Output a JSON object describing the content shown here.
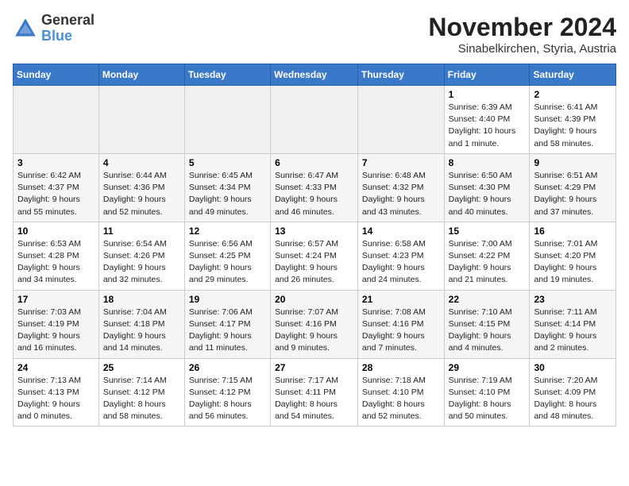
{
  "logo": {
    "line1": "General",
    "line2": "Blue"
  },
  "title": "November 2024",
  "location": "Sinabelkirchen, Styria, Austria",
  "weekdays": [
    "Sunday",
    "Monday",
    "Tuesday",
    "Wednesday",
    "Thursday",
    "Friday",
    "Saturday"
  ],
  "weeks": [
    [
      {
        "day": "",
        "info": ""
      },
      {
        "day": "",
        "info": ""
      },
      {
        "day": "",
        "info": ""
      },
      {
        "day": "",
        "info": ""
      },
      {
        "day": "",
        "info": ""
      },
      {
        "day": "1",
        "info": "Sunrise: 6:39 AM\nSunset: 4:40 PM\nDaylight: 10 hours and 1 minute."
      },
      {
        "day": "2",
        "info": "Sunrise: 6:41 AM\nSunset: 4:39 PM\nDaylight: 9 hours and 58 minutes."
      }
    ],
    [
      {
        "day": "3",
        "info": "Sunrise: 6:42 AM\nSunset: 4:37 PM\nDaylight: 9 hours and 55 minutes."
      },
      {
        "day": "4",
        "info": "Sunrise: 6:44 AM\nSunset: 4:36 PM\nDaylight: 9 hours and 52 minutes."
      },
      {
        "day": "5",
        "info": "Sunrise: 6:45 AM\nSunset: 4:34 PM\nDaylight: 9 hours and 49 minutes."
      },
      {
        "day": "6",
        "info": "Sunrise: 6:47 AM\nSunset: 4:33 PM\nDaylight: 9 hours and 46 minutes."
      },
      {
        "day": "7",
        "info": "Sunrise: 6:48 AM\nSunset: 4:32 PM\nDaylight: 9 hours and 43 minutes."
      },
      {
        "day": "8",
        "info": "Sunrise: 6:50 AM\nSunset: 4:30 PM\nDaylight: 9 hours and 40 minutes."
      },
      {
        "day": "9",
        "info": "Sunrise: 6:51 AM\nSunset: 4:29 PM\nDaylight: 9 hours and 37 minutes."
      }
    ],
    [
      {
        "day": "10",
        "info": "Sunrise: 6:53 AM\nSunset: 4:28 PM\nDaylight: 9 hours and 34 minutes."
      },
      {
        "day": "11",
        "info": "Sunrise: 6:54 AM\nSunset: 4:26 PM\nDaylight: 9 hours and 32 minutes."
      },
      {
        "day": "12",
        "info": "Sunrise: 6:56 AM\nSunset: 4:25 PM\nDaylight: 9 hours and 29 minutes."
      },
      {
        "day": "13",
        "info": "Sunrise: 6:57 AM\nSunset: 4:24 PM\nDaylight: 9 hours and 26 minutes."
      },
      {
        "day": "14",
        "info": "Sunrise: 6:58 AM\nSunset: 4:23 PM\nDaylight: 9 hours and 24 minutes."
      },
      {
        "day": "15",
        "info": "Sunrise: 7:00 AM\nSunset: 4:22 PM\nDaylight: 9 hours and 21 minutes."
      },
      {
        "day": "16",
        "info": "Sunrise: 7:01 AM\nSunset: 4:20 PM\nDaylight: 9 hours and 19 minutes."
      }
    ],
    [
      {
        "day": "17",
        "info": "Sunrise: 7:03 AM\nSunset: 4:19 PM\nDaylight: 9 hours and 16 minutes."
      },
      {
        "day": "18",
        "info": "Sunrise: 7:04 AM\nSunset: 4:18 PM\nDaylight: 9 hours and 14 minutes."
      },
      {
        "day": "19",
        "info": "Sunrise: 7:06 AM\nSunset: 4:17 PM\nDaylight: 9 hours and 11 minutes."
      },
      {
        "day": "20",
        "info": "Sunrise: 7:07 AM\nSunset: 4:16 PM\nDaylight: 9 hours and 9 minutes."
      },
      {
        "day": "21",
        "info": "Sunrise: 7:08 AM\nSunset: 4:16 PM\nDaylight: 9 hours and 7 minutes."
      },
      {
        "day": "22",
        "info": "Sunrise: 7:10 AM\nSunset: 4:15 PM\nDaylight: 9 hours and 4 minutes."
      },
      {
        "day": "23",
        "info": "Sunrise: 7:11 AM\nSunset: 4:14 PM\nDaylight: 9 hours and 2 minutes."
      }
    ],
    [
      {
        "day": "24",
        "info": "Sunrise: 7:13 AM\nSunset: 4:13 PM\nDaylight: 9 hours and 0 minutes."
      },
      {
        "day": "25",
        "info": "Sunrise: 7:14 AM\nSunset: 4:12 PM\nDaylight: 8 hours and 58 minutes."
      },
      {
        "day": "26",
        "info": "Sunrise: 7:15 AM\nSunset: 4:12 PM\nDaylight: 8 hours and 56 minutes."
      },
      {
        "day": "27",
        "info": "Sunrise: 7:17 AM\nSunset: 4:11 PM\nDaylight: 8 hours and 54 minutes."
      },
      {
        "day": "28",
        "info": "Sunrise: 7:18 AM\nSunset: 4:10 PM\nDaylight: 8 hours and 52 minutes."
      },
      {
        "day": "29",
        "info": "Sunrise: 7:19 AM\nSunset: 4:10 PM\nDaylight: 8 hours and 50 minutes."
      },
      {
        "day": "30",
        "info": "Sunrise: 7:20 AM\nSunset: 4:09 PM\nDaylight: 8 hours and 48 minutes."
      }
    ]
  ]
}
